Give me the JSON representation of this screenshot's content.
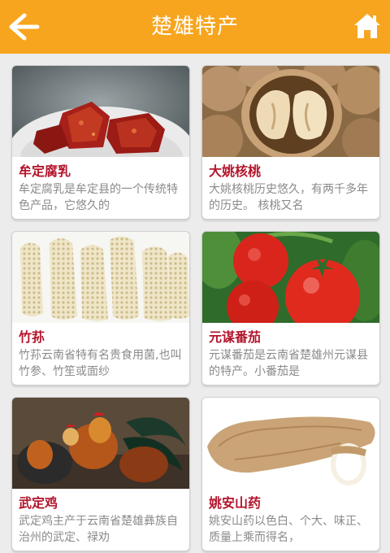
{
  "header": {
    "title": "楚雄特产",
    "color": "#f7a51e",
    "back_icon": "arrow-left-icon",
    "home_icon": "home-icon"
  },
  "items": [
    {
      "name": "牟定腐乳",
      "desc": "牟定腐乳是牟定县的一个传统特色产品，它悠久的"
    },
    {
      "name": "大姚核桃",
      "desc": "大姚核桃历史悠久，有两千多年的历史。 核桃又名"
    },
    {
      "name": "竹荪",
      "desc": "竹荪云南省特有名贵食用菌,也叫竹参、竹笙或面纱"
    },
    {
      "name": "元谋番茄",
      "desc": "元谋番茄是云南省楚雄州元谋县的特产。小番茄是"
    },
    {
      "name": "武定鸡",
      "desc": "武定鸡主产于云南省楚雄彝族自治州的武定、禄劝"
    },
    {
      "name": "姚安山药",
      "desc": "姚安山药以色白、个大、味正、质量上乘而得名，"
    }
  ]
}
